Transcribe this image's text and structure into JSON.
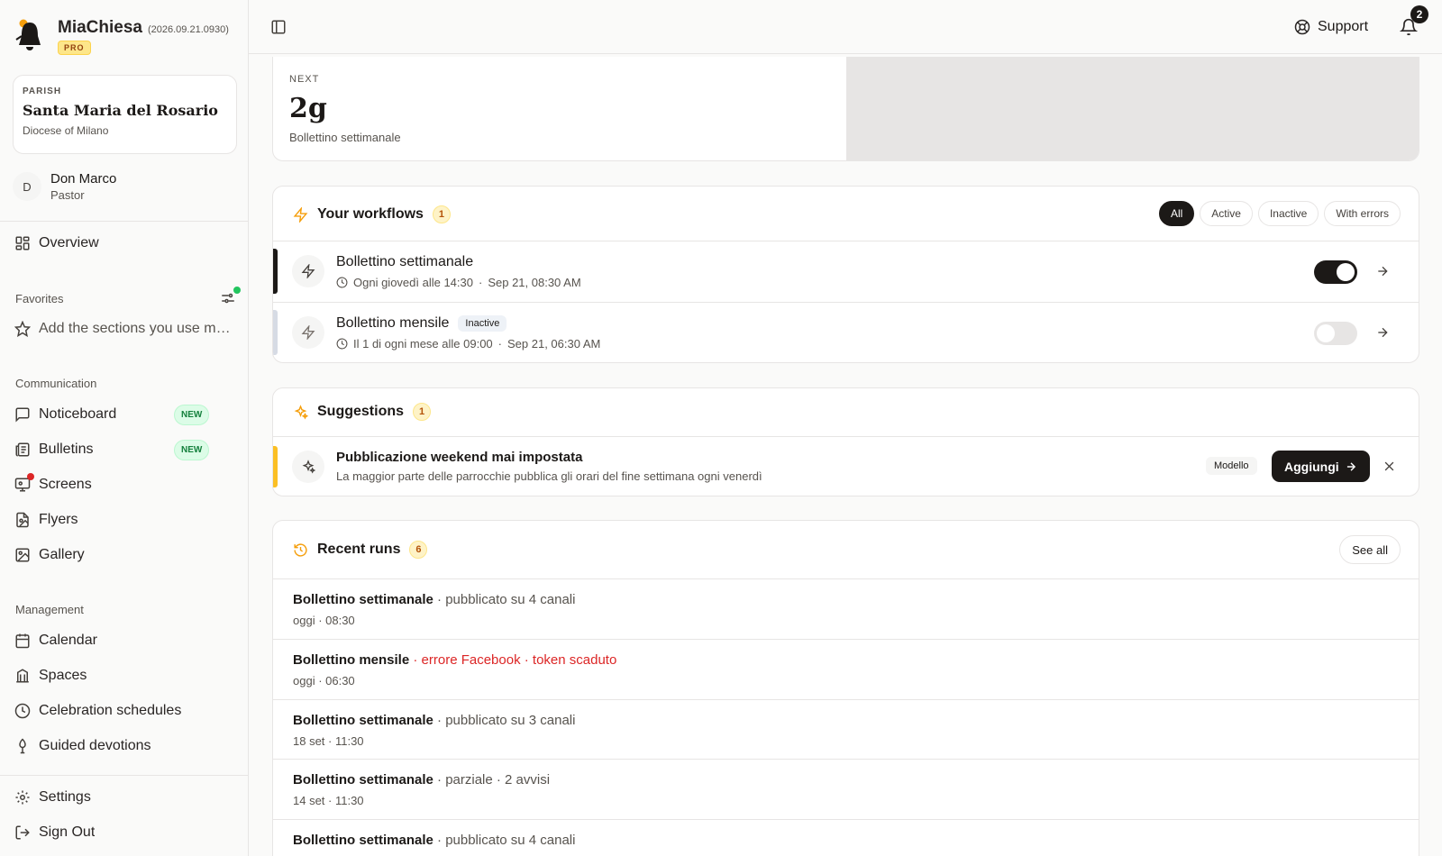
{
  "app": {
    "name": "MiaChiesa",
    "version": "(2026.09.21.0930)",
    "plan_badge": "PRO"
  },
  "parish": {
    "label": "PARISH",
    "name": "Santa Maria del Rosario",
    "diocese": "Diocese of Milano"
  },
  "user": {
    "initial": "D",
    "name": "Don Marco",
    "role": "Pastor"
  },
  "sidebar": {
    "overview": "Overview",
    "favorites_title": "Favorites",
    "favorites_placeholder": "Add the sections you use most",
    "communication_title": "Communication",
    "communication": [
      {
        "label": "Noticeboard",
        "badge": "NEW",
        "icon": "message-square-icon"
      },
      {
        "label": "Bulletins",
        "badge": "NEW",
        "icon": "newspaper-icon"
      },
      {
        "label": "Screens",
        "icon": "monitor-icon"
      },
      {
        "label": "Flyers",
        "icon": "file-image-icon"
      },
      {
        "label": "Gallery",
        "icon": "images-icon"
      }
    ],
    "management_title": "Management",
    "management": [
      {
        "label": "Calendar",
        "icon": "calendar-icon"
      },
      {
        "label": "Spaces",
        "icon": "building-icon"
      },
      {
        "label": "Celebration schedules",
        "icon": "clock-icon"
      },
      {
        "label": "Guided devotions",
        "icon": "candle-icon"
      }
    ],
    "settings": "Settings",
    "sign_out": "Sign Out"
  },
  "topbar": {
    "support": "Support",
    "notifications_count": "2"
  },
  "next": {
    "label": "NEXT",
    "value": "2g",
    "subtitle": "Bollettino settimanale"
  },
  "workflows": {
    "title": "Your workflows",
    "count": "1",
    "filters": [
      "All",
      "Active",
      "Inactive",
      "With errors"
    ],
    "selected_filter": "All",
    "items": [
      {
        "name": "Bollettino settimanale",
        "schedule": "Ogni giovedì alle 14:30",
        "last_run": "Sep 21, 08:30 AM",
        "enabled": true,
        "status": ""
      },
      {
        "name": "Bollettino mensile",
        "schedule": "Il 1 di ogni mese alle 09:00",
        "last_run": "Sep 21, 06:30 AM",
        "enabled": false,
        "status": "Inactive"
      }
    ]
  },
  "suggestions": {
    "title": "Suggestions",
    "count": "1",
    "items": [
      {
        "title": "Pubblicazione weekend mai impostata",
        "description": "La maggior parte delle parrocchie pubblica gli orari del fine settimana ogni venerdì",
        "tag": "Modello",
        "action": "Aggiungi"
      }
    ]
  },
  "recent_runs": {
    "title": "Recent runs",
    "count": "6",
    "see_all": "See all",
    "items": [
      {
        "title": "Bollettino settimanale",
        "detail": " · pubblicato su 4 canali",
        "time": "oggi · 08:30",
        "error": false
      },
      {
        "title": "Bollettino mensile",
        "detail": " · errore Facebook · token scaduto",
        "time": "oggi · 06:30",
        "error": true
      },
      {
        "title": "Bollettino settimanale",
        "detail": " · pubblicato su 3 canali",
        "time": "18 set · 11:30",
        "error": false
      },
      {
        "title": "Bollettino settimanale",
        "detail": " · parziale · 2 avvisi",
        "time": "14 set · 11:30",
        "error": false
      },
      {
        "title": "Bollettino settimanale",
        "detail": " · pubblicato su 4 canali",
        "time": "",
        "error": false
      }
    ]
  },
  "colors": {
    "accent_dark": "#1c1917",
    "warning_bar": "#fbbf24",
    "error_text": "#dc2626",
    "new_badge": "#dcfce7"
  }
}
